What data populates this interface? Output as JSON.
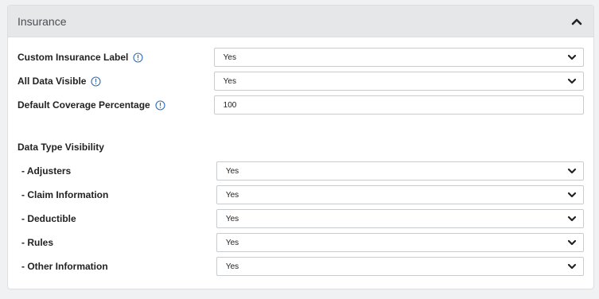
{
  "panel": {
    "title": "Insurance"
  },
  "fields": [
    {
      "label": "Custom Insurance Label",
      "value": "Yes",
      "type": "select"
    },
    {
      "label": "All Data Visible",
      "value": "Yes",
      "type": "select"
    },
    {
      "label": "Default Coverage Percentage",
      "value": "100",
      "type": "input"
    }
  ],
  "section": {
    "heading": "Data Type Visibility"
  },
  "visibility": [
    {
      "label": "- Adjusters",
      "value": "Yes"
    },
    {
      "label": "- Claim Information",
      "value": "Yes"
    },
    {
      "label": "- Deductible",
      "value": "Yes"
    },
    {
      "label": "- Rules",
      "value": "Yes"
    },
    {
      "label": "- Other Information",
      "value": "Yes"
    }
  ],
  "icons": {
    "info": "info-icon",
    "collapse": "chevron-up-icon",
    "dropdown": "chevron-down-icon"
  },
  "colors": {
    "info": "#2e6fb8",
    "header": "#e6e7e9"
  }
}
